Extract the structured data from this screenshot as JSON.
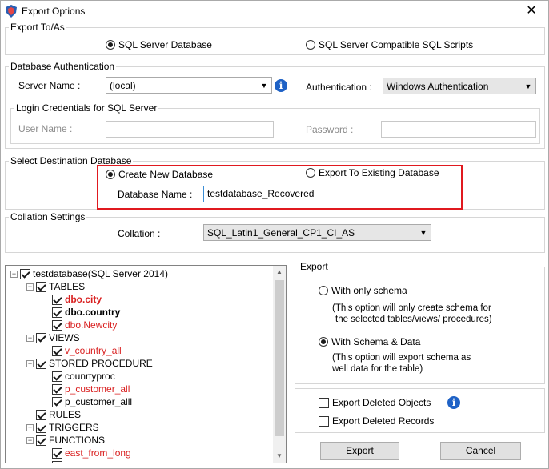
{
  "window": {
    "title": "Export Options",
    "close_glyph": "✕"
  },
  "export_to": {
    "legend": "Export To/As",
    "opt_sql_server": "SQL Server Database",
    "opt_scripts": "SQL Server Compatible SQL Scripts"
  },
  "db_auth": {
    "legend": "Database Authentication",
    "server_name_label": "Server Name :",
    "server_name_value": "(local)",
    "authentication_label": "Authentication :",
    "authentication_value": "Windows Authentication",
    "login_legend": "Login Credentials for SQL Server",
    "user_name_label": "User Name :",
    "password_label": "Password :"
  },
  "destination": {
    "legend": "Select Destination Database",
    "opt_create_new": "Create New Database",
    "opt_existing": "Export To Existing Database",
    "db_name_label": "Database Name :",
    "db_name_value": "testdatabase_Recovered"
  },
  "collation": {
    "legend": "Collation Settings",
    "label": "Collation :",
    "value": "SQL_Latin1_General_CP1_CI_AS"
  },
  "tree": {
    "root": "testdatabase(SQL Server 2014)",
    "tables": "TABLES",
    "t1": "dbo.city",
    "t2": "dbo.country",
    "t3": "dbo.Newcity",
    "views": "VIEWS",
    "v1": "v_country_all",
    "procs": "STORED PROCEDURE",
    "p1": "counrtyproc",
    "p2": "p_customer_all",
    "p3": "p_customer_alll",
    "rules": "RULES",
    "triggers": "TRIGGERS",
    "functions": "FUNCTIONS",
    "f1": "east_from_long"
  },
  "export_panel": {
    "legend": "Export",
    "opt_schema": "With only schema",
    "schema_desc_1": "(This option will only create schema for",
    "schema_desc_2": "the  selected tables/views/ procedures)",
    "opt_schema_data": "With Schema & Data",
    "data_desc_1": "(This option will export schema as",
    "data_desc_2": "well data for the table)"
  },
  "deleted": {
    "objects": "Export Deleted Objects",
    "records": "Export Deleted Records"
  },
  "buttons": {
    "export": "Export",
    "cancel": "Cancel"
  },
  "colors": {
    "highlight": "#e0191f",
    "info": "#1f62c6",
    "deleted_item": "#d91f1f"
  },
  "icons": {
    "app": "shield-app-icon",
    "info": "info-icon"
  }
}
